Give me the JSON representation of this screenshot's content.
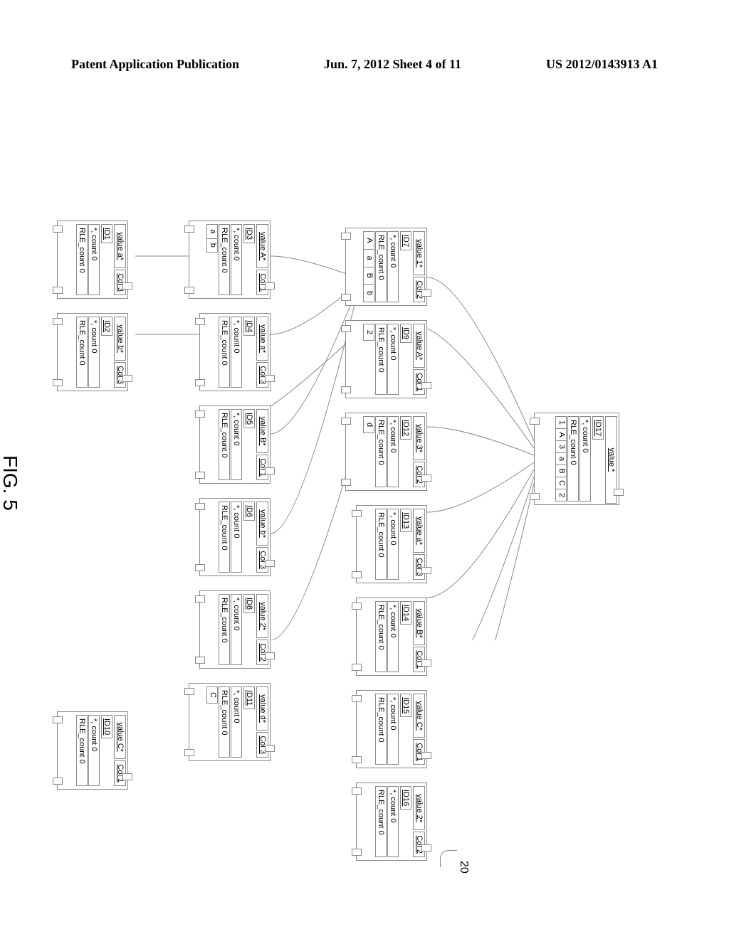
{
  "header": {
    "left": "Patent Application Publication",
    "center": "Jun. 7, 2012  Sheet 4 of 11",
    "right": "US 2012/0143913 A1"
  },
  "figure": {
    "label": "FIG. 5",
    "ref_num": "20"
  },
  "root_node": {
    "value": "value *",
    "id": "ID17",
    "count": "*, count 0",
    "rle": "RLE_count 0",
    "children_row": [
      "1",
      "A",
      "3",
      "a",
      "B",
      "C",
      "2"
    ]
  },
  "nodes": {
    "id1": {
      "value": "value a*",
      "id": "ID1",
      "col": "Col 3",
      "count": "*, count 0",
      "rle": "RLE_count 0"
    },
    "id2": {
      "value": "value b*",
      "id": "ID2",
      "col": "Col 3",
      "count": "*, count 0",
      "rle": "RLE_count 0"
    },
    "id3": {
      "value": "value A*",
      "id": "ID3",
      "col": "Col 1",
      "count": "*, count 0",
      "rle": "RLE_count 0",
      "children": [
        "a",
        "b"
      ]
    },
    "id4": {
      "value": "value a*",
      "id": "ID4",
      "col": "Col 3",
      "count": "*, count 0",
      "rle": "RLE_count 0"
    },
    "id5": {
      "value": "value B*",
      "id": "ID5",
      "col": "Col 1",
      "count": "*, count 0",
      "rle": "RLE_count 0"
    },
    "id6": {
      "value": "value b*",
      "id": "ID6",
      "col": "Col 3",
      "count": "*, count 0",
      "rle": "RLE_count 0"
    },
    "id7": {
      "value": "value 1*",
      "id": "ID7",
      "col": "Col 2",
      "count": "*, count 0",
      "rle": "RLE_count 0",
      "children": [
        "A",
        "a",
        "B",
        "b"
      ]
    },
    "id8": {
      "value": "value 2*",
      "id": "ID8",
      "col": "Col 2",
      "count": "*, count 0",
      "rle": "RLE_count 0"
    },
    "id9": {
      "value": "value A*",
      "id": "ID9",
      "col": "Col 1",
      "count": "*, count 0",
      "rle": "RLE_count 0",
      "children": [
        "2"
      ]
    },
    "id10": {
      "value": "value C*",
      "id": "ID10",
      "col": "Col 1",
      "count": "*, count 0",
      "rle": "RLE_count 0"
    },
    "id11": {
      "value": "value d*",
      "id": "ID11",
      "col": "Col 3",
      "count": "*, count 0",
      "rle": "RLE_count 0",
      "children": [
        "C"
      ]
    },
    "id12": {
      "value": "value 3*",
      "id": "ID12",
      "col": "Col 2",
      "count": "*, count 0",
      "rle": "RLE_count 0",
      "children": [
        "d"
      ]
    },
    "id13": {
      "value": "value a*",
      "id": "ID13",
      "col": "Col 3",
      "count": "*, count 0",
      "rle": "RLE_count 0"
    },
    "id14": {
      "value": "value B*",
      "id": "ID14",
      "col": "Col 1",
      "count": "*, count 0",
      "rle": "RLE_count 0"
    },
    "id15": {
      "value": "value C*",
      "id": "ID15",
      "col": "Col 1",
      "count": "*, count 0",
      "rle": "RLE_count 0"
    },
    "id16": {
      "value": "value 2*",
      "id": "ID16",
      "col": "Col 2",
      "count": "*, count 0",
      "rle": "RLE_count 0"
    }
  }
}
